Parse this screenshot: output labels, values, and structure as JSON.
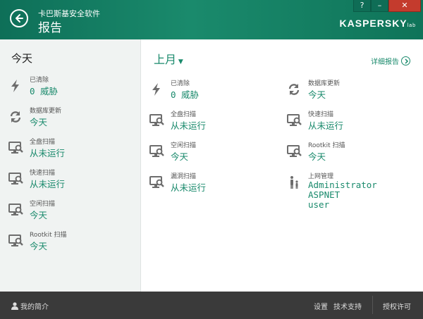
{
  "header": {
    "app_name": "卡巴斯基安全软件",
    "title": "报告",
    "brand": "KASPERSKY",
    "brand_suffix": "lab",
    "help_label": "?",
    "minimize_label": "–",
    "close_label": "✕"
  },
  "left": {
    "title": "今天",
    "items": [
      {
        "icon": "lightning-icon",
        "label": "已清除",
        "value": "0 威胁"
      },
      {
        "icon": "refresh-icon",
        "label": "数据库更新",
        "value": "今天"
      },
      {
        "icon": "scan-monitor-icon",
        "label": "全盘扫描",
        "value": "从未运行"
      },
      {
        "icon": "scan-monitor-icon",
        "label": "快速扫描",
        "value": "从未运行"
      },
      {
        "icon": "scan-monitor-icon",
        "label": "空闲扫描",
        "value": "今天"
      },
      {
        "icon": "scan-monitor-icon",
        "label": "Rootkit 扫描",
        "value": "今天"
      }
    ]
  },
  "right": {
    "period": "上月",
    "detail_link": "详细报告",
    "col1": [
      {
        "icon": "lightning-icon",
        "label": "已清除",
        "value": "0 威胁"
      },
      {
        "icon": "scan-monitor-icon",
        "label": "全盘扫描",
        "value": "从未运行"
      },
      {
        "icon": "scan-monitor-icon",
        "label": "空闲扫描",
        "value": "今天"
      },
      {
        "icon": "scan-monitor-icon",
        "label": "漏洞扫描",
        "value": "从未运行"
      }
    ],
    "col2": [
      {
        "icon": "refresh-icon",
        "label": "数据库更新",
        "value": "今天"
      },
      {
        "icon": "scan-monitor-icon",
        "label": "快速扫描",
        "value": "从未运行"
      },
      {
        "icon": "scan-monitor-icon",
        "label": "Rootkit 扫描",
        "value": "今天"
      },
      {
        "icon": "parental-control-icon",
        "label": "上网管理",
        "values": [
          "Administrator",
          "ASPNET",
          "user"
        ]
      }
    ]
  },
  "footer": {
    "profile": "我的简介",
    "settings": "设置",
    "support": "技术支持",
    "license": "授权许可"
  },
  "colors": {
    "accent": "#1a8a6c",
    "header_bg": "#0f7459",
    "footer_bg": "#3a3a3a",
    "close_btn": "#c43b2d"
  }
}
